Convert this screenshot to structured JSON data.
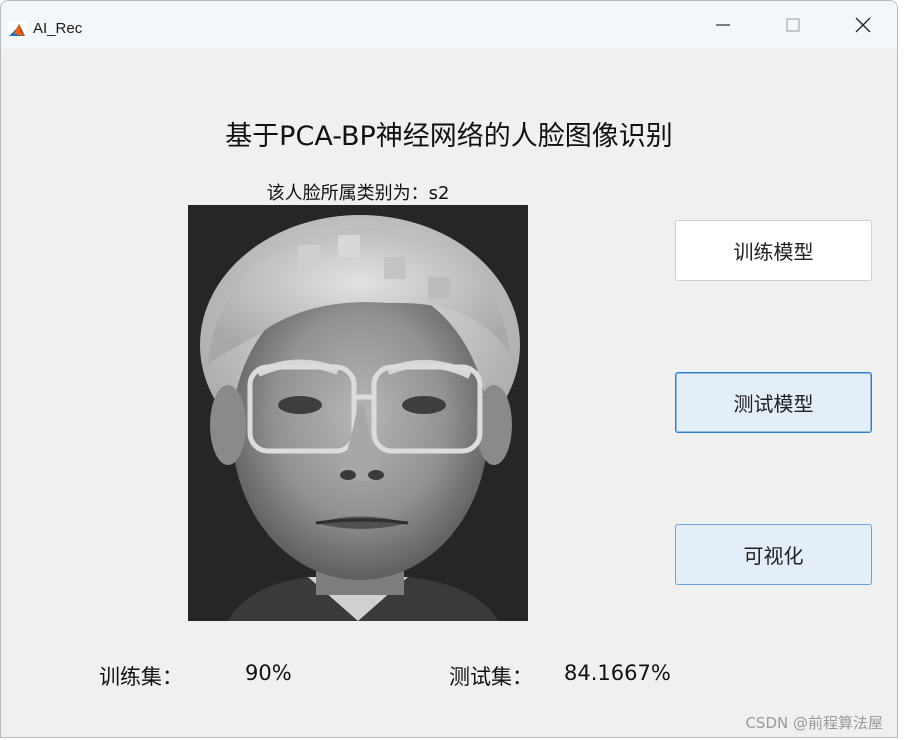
{
  "window": {
    "title": "AI_Rec"
  },
  "main": {
    "heading": "基于PCA-BP神经网络的人脸图像识别",
    "result_text": "该人脸所属类别为：s2"
  },
  "buttons": {
    "train": "训练模型",
    "test": "测试模型",
    "visualize": "可视化"
  },
  "stats": {
    "train_label": "训练集：",
    "train_value": "90%",
    "test_label": "测试集：",
    "test_value": "84.1667%"
  },
  "watermark": "CSDN @前程算法屋",
  "colors": {
    "window_bg": "#f0f0f0",
    "titlebar_bg": "#f4f7fa",
    "button_active_border": "#2a7fd4",
    "button_active_bg": "#e3eef8"
  }
}
